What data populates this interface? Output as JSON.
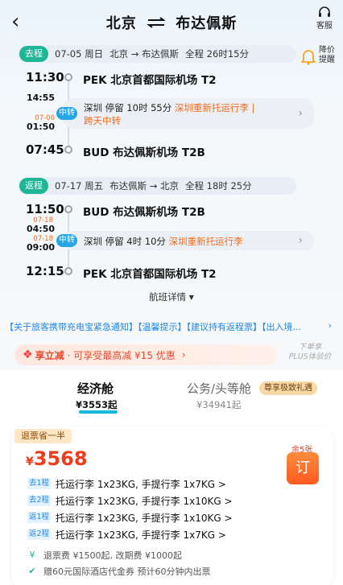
{
  "header": {
    "title_from": "北京",
    "title_to": "布达佩斯",
    "service_label": "客服"
  },
  "outbound": {
    "tag": "去程",
    "date": "07-05 周日",
    "route": "北京 → 布达佩斯",
    "duration": "全程 26时15分",
    "dep_time": "11:30",
    "dep_airport": "PEK 北京首都国际机场 T2",
    "transit_arr_time": "14:55",
    "transit_dep_date": "07-06",
    "transit_dep_time": "01:50",
    "transit_tag": "中转",
    "transit_text": "深圳  停留 10时 55分",
    "transit_note": "深圳重新托运行李",
    "transit_note2": "跨天中转",
    "arr_time": "07:45",
    "arr_airport": "BUD 布达佩斯机场 T2B"
  },
  "reminder": {
    "label": "降价提醒"
  },
  "return": {
    "tag": "返程",
    "date": "07-17 周五",
    "route": "布达佩斯 → 北京",
    "duration": "全程 18时 25分",
    "dep_time": "11:50",
    "dep_airport": "BUD 布达佩斯机场 T2B",
    "transit_arr_date": "07-18",
    "transit_arr_time": "04:50",
    "transit_dep_date": "07-18",
    "transit_dep_time": "09:00",
    "transit_tag": "中转",
    "transit_text": "深圳  停留 4时 10分",
    "transit_note": "深圳重新托运行李",
    "arr_time": "12:15",
    "arr_airport": "PEK 北京首都国际机场 T2"
  },
  "detail_link": "航班详情",
  "notice": "【关于旅客携带充电宝紧急通知】【温馨提示】【建议持有返程票】【出入境...",
  "promo": {
    "name": "享立减",
    "text": "· 可享受最高减 ¥15 优惠",
    "plus_line1": "下单享",
    "plus_line2": "PLUS体验价"
  },
  "cabins": {
    "economy_label": "经济舱",
    "economy_price": "¥3553起",
    "business_label": "公务/头等舱",
    "business_badge": "尊享极致礼遇",
    "business_price": "¥34941起"
  },
  "offer": {
    "badge": "退票省一半",
    "currency": "¥",
    "price": "3568",
    "remaining": "余5张",
    "book_label": "订",
    "luggage": [
      {
        "tag": "去1程",
        "text": "托运行李 1x23KG,  手提行李 1x7KG >"
      },
      {
        "tag": "去2程",
        "text": "托运行李 1x23KG,  手提行李 1x10KG >"
      },
      {
        "tag": "返1程",
        "text": "托运行李 1x23KG,  手提行李 1x10KG >"
      },
      {
        "tag": "返2程",
        "text": "托运行李 1x23KG,  手提行李 1x7KG >"
      }
    ],
    "fee_text": "退票费 ¥1500起,  改期费 ¥1000起",
    "voucher_text": "赠60元国际酒店代金券 预计60分钟内出票"
  },
  "colors": {
    "accent_green": "#1fb597",
    "accent_blue": "#26a6e6",
    "orange": "#f26b1c",
    "price_red": "#f23a1c"
  }
}
